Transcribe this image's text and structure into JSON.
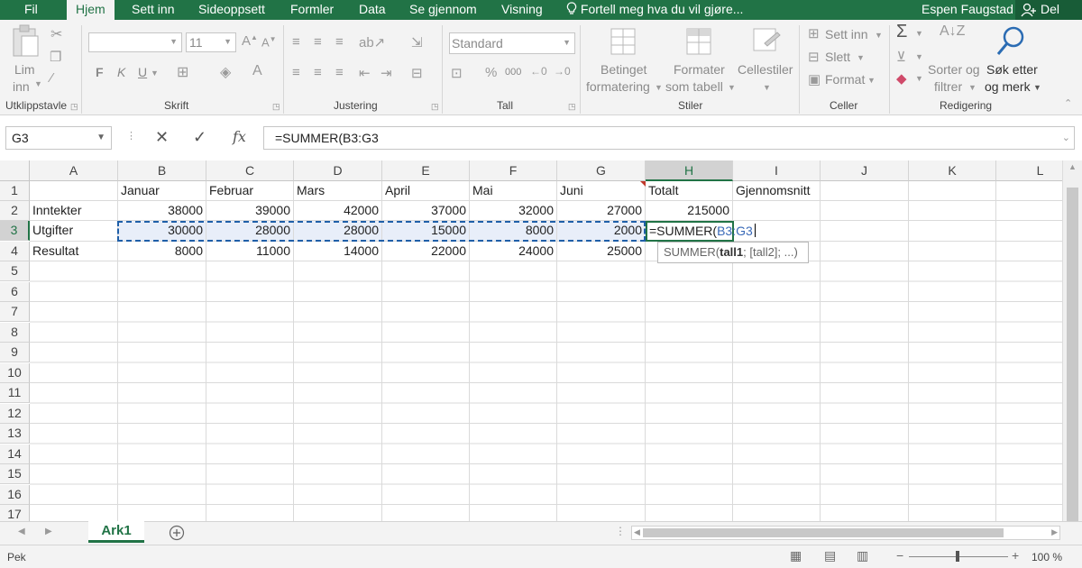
{
  "tabs": {
    "file": "Fil",
    "home": "Hjem",
    "insert": "Sett inn",
    "page_layout": "Sideoppsett",
    "formulas": "Formler",
    "data": "Data",
    "review": "Se gjennom",
    "view": "Visning",
    "tell_me": "Fortell meg hva du vil gjøre...",
    "user": "Espen Faugstad",
    "share": "Del"
  },
  "ribbon": {
    "paste_line1": "Lim",
    "paste_line2": "inn",
    "clipboard": "Utklippstavle",
    "font_size": "11",
    "bold": "F",
    "italic": "K",
    "underline": "U",
    "font": "Skrift",
    "alignment": "Justering",
    "number_format": "Standard",
    "thousands": "000",
    "number": "Tall",
    "cond_line1": "Betinget",
    "cond_line2": "formatering",
    "table_line1": "Formater",
    "table_line2": "som tabell",
    "cell_styles": "Cellestiler",
    "styles": "Stiler",
    "insert": "Sett inn",
    "delete": "Slett",
    "format": "Format",
    "cells": "Celler",
    "sort_line1": "Sorter og",
    "sort_line2": "filtrer",
    "find_line1": "Søk etter",
    "find_line2": "og merk",
    "editing": "Redigering"
  },
  "icons": {
    "paste": "clipboard-icon",
    "cut": "scissors-icon",
    "copy": "copy-icon",
    "format_painter": "brush-icon",
    "sum": "sigma-icon",
    "fill": "fill-down-icon",
    "clear": "eraser-icon",
    "sort": "sort-az-icon",
    "find": "magnifier-icon",
    "tell_me": "lightbulb-icon",
    "share": "person-add-icon",
    "cancel": "x-icon",
    "enter": "check-icon",
    "function": "fx-icon",
    "new_sheet": "plus-circle-icon",
    "normal_view": "grid-view-icon",
    "page_layout_view": "page-layout-icon",
    "page_break_view": "page-break-icon"
  },
  "formula_bar": {
    "name_box": "G3",
    "fx": "fx",
    "formula": "=SUMMER(B3:G3"
  },
  "columns": [
    "A",
    "B",
    "C",
    "D",
    "E",
    "F",
    "G",
    "H",
    "I",
    "J",
    "K",
    "L"
  ],
  "rows": [
    "1",
    "2",
    "3",
    "4",
    "5",
    "6",
    "7",
    "8",
    "9",
    "10",
    "11",
    "12",
    "13",
    "14",
    "15",
    "16",
    "17"
  ],
  "cells": {
    "r1": [
      "",
      "Januar",
      "Februar",
      "Mars",
      "April",
      "Mai",
      "Juni",
      "Totalt",
      "Gjennomsnitt"
    ],
    "r2": [
      "Inntekter",
      "38000",
      "39000",
      "42000",
      "37000",
      "32000",
      "27000",
      "215000",
      ""
    ],
    "r3": [
      "Utgifter",
      "30000",
      "28000",
      "28000",
      "15000",
      "8000",
      "2000",
      "",
      ""
    ],
    "r4": [
      "Resultat",
      "8000",
      "11000",
      "14000",
      "22000",
      "24000",
      "25000",
      "",
      ""
    ]
  },
  "edit_cell": {
    "prefix": "=SUMMER(",
    "ref": "B3:G3"
  },
  "tooltip": {
    "fn": "SUMMER(",
    "arg1": "tall1",
    "rest": "; [tall2]; ...)"
  },
  "sheet_tab": "Ark1",
  "status": {
    "mode": "Pek",
    "zoom": "100 %"
  },
  "colors": {
    "accent": "#217346",
    "marquee": "#1f5fa8",
    "highlight": "#e8eef9"
  }
}
